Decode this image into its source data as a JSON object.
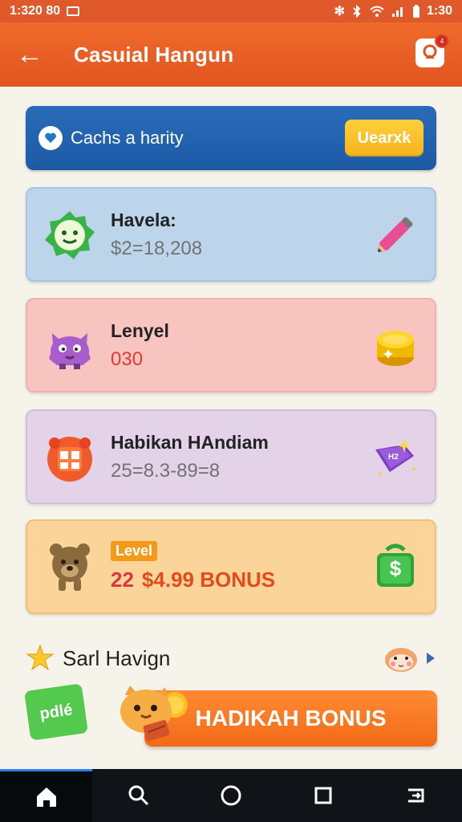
{
  "status_bar": {
    "left_time": "1:320 80",
    "right_time": "1:30"
  },
  "app_bar": {
    "title": "Casuial Hangun",
    "notification_badge": "4"
  },
  "banner": {
    "text": "Cachs a harity",
    "button_label": "Uearxk"
  },
  "cards": [
    {
      "title": "Havela:",
      "value": "$2=18,208",
      "value_color": "#727272"
    },
    {
      "title": "Lenyel",
      "value": "030",
      "value_color": "#e03a35"
    },
    {
      "title": "Habikan HAndiam",
      "value": "25=8.3-89=8",
      "value_color": "#727272"
    },
    {
      "badge": "Level",
      "number": "22",
      "bonus": "$4.99 BONUS"
    }
  ],
  "section": {
    "title": "Sarl Havign"
  },
  "tag_label": "pdlé",
  "main_button_label": "HADIKAH BONUS",
  "colors": {
    "accent": "#e1551f",
    "banner": "#1c5aa6",
    "button": "#f26a17"
  }
}
